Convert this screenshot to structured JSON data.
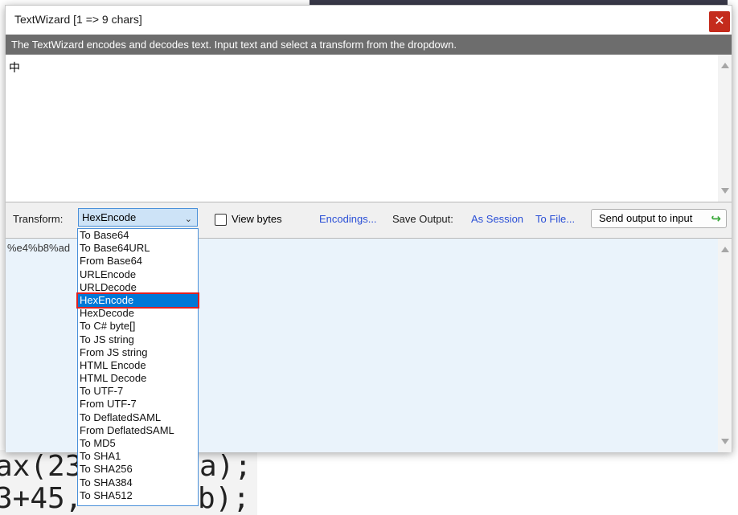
{
  "window": {
    "title": "TextWizard [1 => 9 chars]",
    "close_glyph": "✕"
  },
  "info_bar": {
    "text": "The TextWizard encodes and decodes text. Input text and select a transform from the dropdown."
  },
  "input": {
    "value": "中"
  },
  "toolbar": {
    "transform_label": "Transform:",
    "transform_selected": "HexEncode",
    "view_bytes_label": "View bytes",
    "encodings_link": "Encodings...",
    "save_output_label": "Save Output:",
    "as_session_link": "As Session",
    "to_file_link": "To File...",
    "send_button_label": "Send output to input"
  },
  "output": {
    "value": "%e4%b8%ad"
  },
  "dropdown": {
    "selected_index": 5,
    "items": [
      "To Base64",
      "To Base64URL",
      "From Base64",
      "URLEncode",
      "URLDecode",
      "HexEncode",
      "HexDecode",
      "To C# byte[]",
      "To JS string",
      "From JS string",
      "HTML Encode",
      "HTML Decode",
      "To UTF-7",
      "From UTF-7",
      "To DeflatedSAML",
      "From DeflatedSAML",
      "To MD5",
      "To SHA1",
      "To SHA256",
      "To SHA384",
      "To SHA512"
    ]
  },
  "background": {
    "fragment_1": "ax(23",
    "fragment_2": "a);",
    "fragment_3": "3+45,",
    "fragment_4": "b);"
  },
  "colors": {
    "accent": "#0078d7",
    "highlight_border": "#e02020",
    "link": "#2a4fd6",
    "info_bar": "#6d6d6d",
    "close_button": "#c42b1c"
  },
  "icons": {
    "close": "close-icon",
    "dropdown": "chevron-down-icon",
    "send": "send-arrow-icon"
  }
}
